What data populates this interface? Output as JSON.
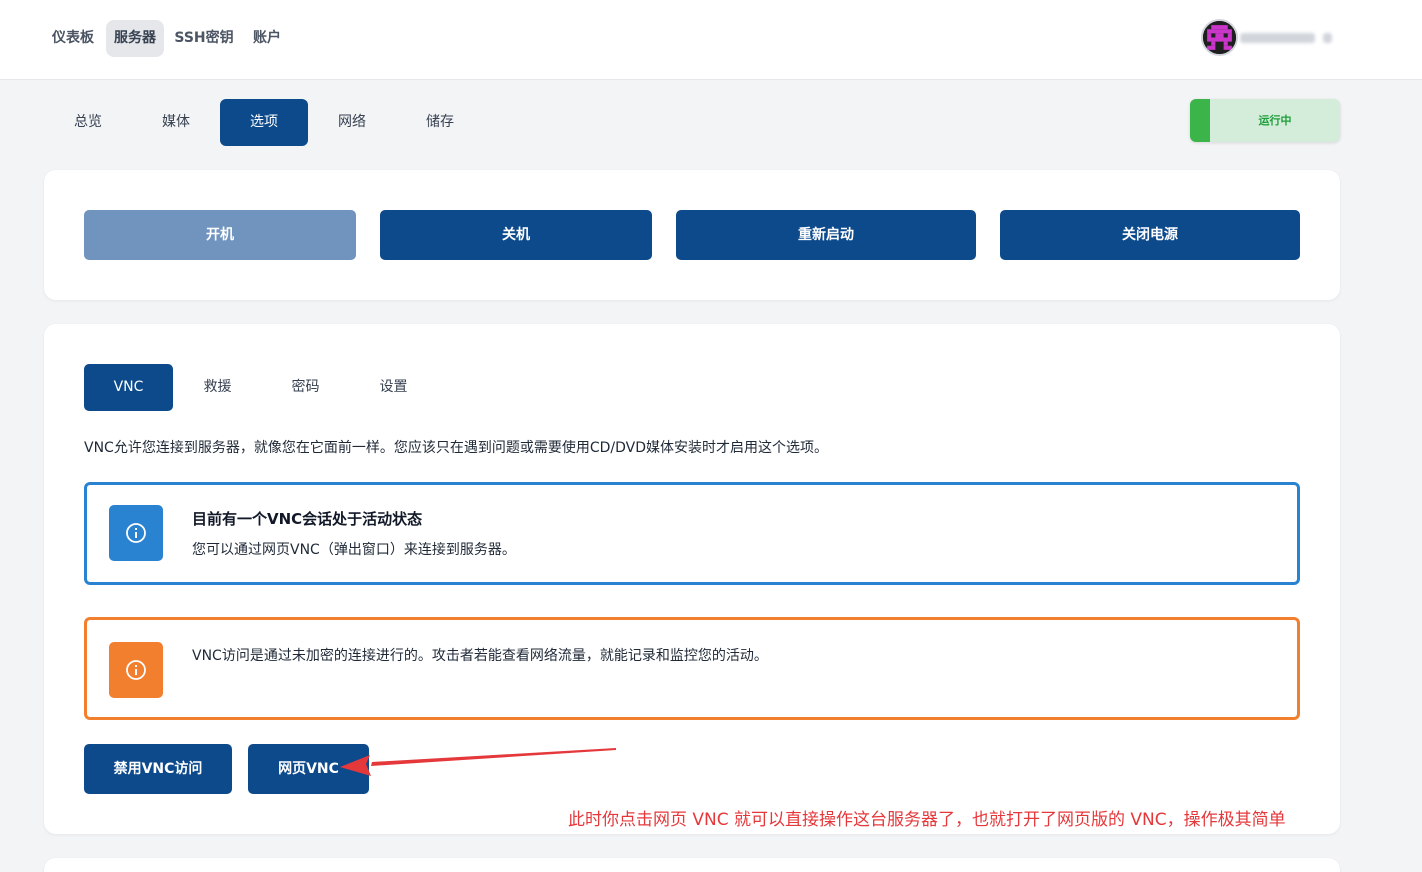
{
  "topnav": {
    "items": [
      {
        "label": "仪表板",
        "active": false
      },
      {
        "label": "服务器",
        "active": true
      },
      {
        "label": "SSH密钥",
        "active": false
      },
      {
        "label": "账户",
        "active": false
      }
    ]
  },
  "server_tabs": [
    {
      "label": "总览",
      "active": false
    },
    {
      "label": "媒体",
      "active": false
    },
    {
      "label": "选项",
      "active": true
    },
    {
      "label": "网络",
      "active": false
    },
    {
      "label": "储存",
      "active": false
    }
  ],
  "status": {
    "label": "运行中",
    "color": "#3bb44a"
  },
  "power_buttons": [
    {
      "label": "开机",
      "disabled": true
    },
    {
      "label": "关机",
      "disabled": false
    },
    {
      "label": "重新启动",
      "disabled": false
    },
    {
      "label": "关闭电源",
      "disabled": false
    }
  ],
  "vnc_tabs": [
    {
      "label": "VNC",
      "active": true
    },
    {
      "label": "救援",
      "active": false
    },
    {
      "label": "密码",
      "active": false
    },
    {
      "label": "设置",
      "active": false
    }
  ],
  "vnc": {
    "description": "VNC允许您连接到服务器，就像您在它面前一样。您应该只在遇到问题或需要使用CD/DVD媒体安装时才启用这个选项。",
    "info_alert": {
      "title": "目前有一个VNC会话处于活动状态",
      "text": "您可以通过网页VNC（弹出窗口）来连接到服务器。",
      "icon": "info-icon"
    },
    "warning_alert": {
      "text": "VNC访问是通过未加密的连接进行的。攻击者若能查看网络流量，就能记录和监控您的活动。",
      "icon": "info-icon"
    },
    "disable_button": "禁用VNC访问",
    "web_vnc_button": "网页VNC"
  },
  "annotation": "此时你点击网页 VNC 就可以直接操作这台服务器了，也就打开了网页版的 VNC，操作极其简单",
  "colors": {
    "primary": "#0d4a8c",
    "primary_disabled": "#7194bf",
    "info": "#2a83d0",
    "warning": "#f27f2d",
    "annotation": "#e5383b"
  }
}
